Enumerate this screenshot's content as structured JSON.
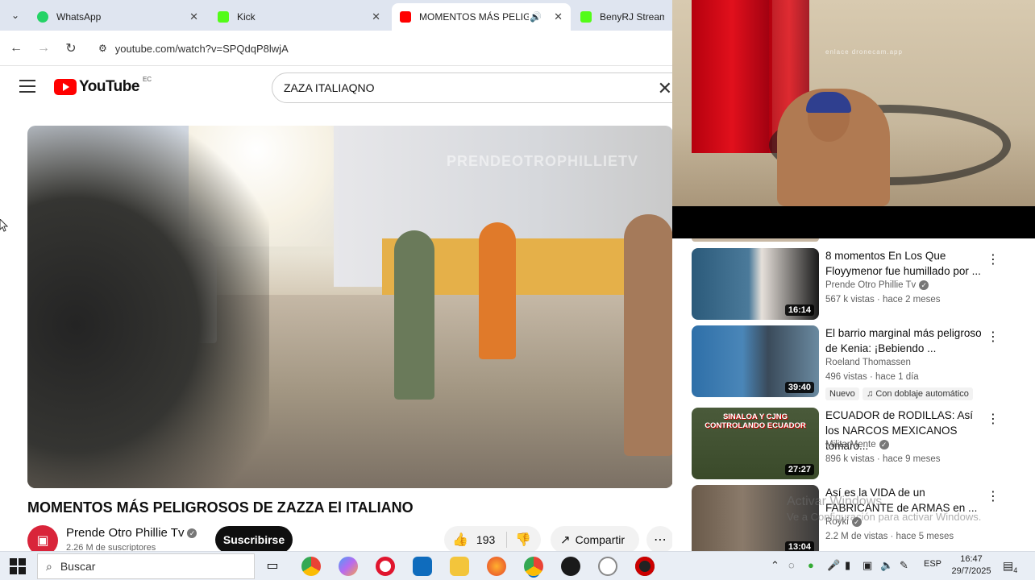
{
  "browser": {
    "tabs": [
      {
        "title": "WhatsApp",
        "color": "#25d366"
      },
      {
        "title": "Kick",
        "color": "#53fc18"
      },
      {
        "title": "MOMENTOS MÁS PELIGRO",
        "color": "#ff0000"
      },
      {
        "title": "BenyRJ Stream - W",
        "color": "#53fc18"
      }
    ],
    "url": "youtube.com/watch?v=SPQdqP8lwjA"
  },
  "youtube": {
    "logo_text": "YouTube",
    "country_code": "EC",
    "search_value": "ZAZA ITALIAQNO",
    "video_watermark": "PRENDEOTROPHILLIETV",
    "video_title": "MOMENTOS MÁS PELIGROSOS DE ZAZZA El ITALIANO",
    "channel_name": "Prende Otro Phillie Tv",
    "subscribers": "2.26 M de suscriptores",
    "subscribe_label": "Suscribirse",
    "likes": "193",
    "share_label": "Compartir"
  },
  "webcam": {
    "watermark": "enlace dronecam.app"
  },
  "recommendations": [
    {
      "title": "8 momentos En Los Que Floyymenor fue humillado por ...",
      "channel": "Prende Otro Phillie Tv",
      "verified": true,
      "meta": "567 k vistas · hace 2 meses",
      "duration": "16:14",
      "badges": []
    },
    {
      "title": "El barrio marginal más peligroso de Kenia: ¡Bebiendo ...",
      "channel": "Roeland Thomassen",
      "verified": false,
      "meta": "496 vistas · hace 1 día",
      "duration": "39:40",
      "badges": [
        "Nuevo",
        "Con doblaje automático"
      ]
    },
    {
      "title": "ECUADOR de RODILLAS: Así los NARCOS MEXICANOS tomaro...",
      "channel": "MilitarMente",
      "verified": true,
      "meta": "896 k vistas · hace 9 meses",
      "duration": "27:27",
      "badges": [],
      "thumb_text": "SINALOA Y CJNG CONTROLANDO ECUADOR"
    },
    {
      "title": "Así es la VIDA de un FABRICANTE de ARMAS en ...",
      "channel": "Royki",
      "verified": true,
      "meta": "2.2 M de vistas · hace 5 meses",
      "duration": "13:04",
      "badges": []
    }
  ],
  "windows": {
    "activate_line1": "Activar Windows",
    "activate_line2": "Ve a Configuración para activar Windows.",
    "search_label": "Buscar",
    "language": "ESP",
    "time": "16:47",
    "date": "29/7/2025",
    "notifications": "4"
  }
}
